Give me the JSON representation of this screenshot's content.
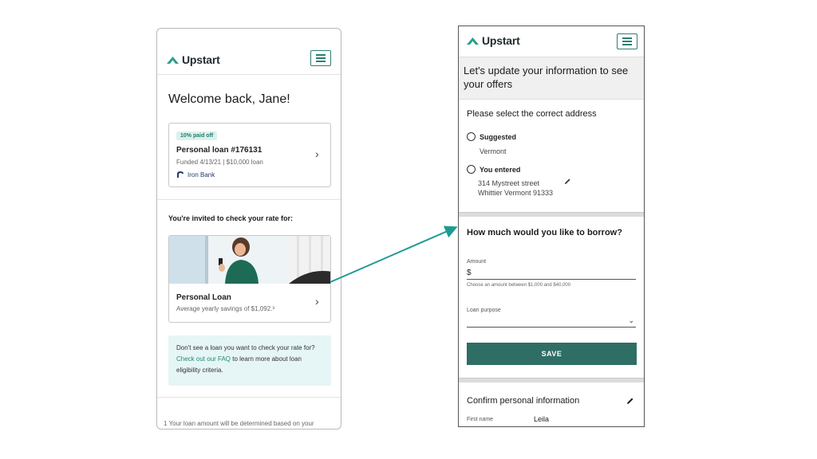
{
  "left_screen": {
    "brand": "Upstart",
    "welcome": "Welcome back, Jane!",
    "loan_card": {
      "badge": "10% paid off",
      "title": "Personal loan #176131",
      "subtitle": "Funded 4/13/21 | $10,000 loan",
      "bank": "Iron Bank"
    },
    "invite_heading": "You're invited to check your rate for:",
    "offer_card": {
      "title": "Personal Loan",
      "subtitle": "Average yearly savings of $1,092.³"
    },
    "faq": {
      "before": "Don't see a loan you want to check your rate for? ",
      "link": "Check out our FAQ",
      "after": " to learn more about loan eligibility criteria."
    },
    "footnote": "1 Your loan amount will be determined based on your"
  },
  "right_screen": {
    "brand": "Upstart",
    "banner": "Let's update your information to see your offers",
    "address": {
      "title": "Please select the correct address",
      "suggested_label": "Suggested",
      "suggested_value": "Vermont",
      "entered_label": "You entered",
      "entered_line1": "314 Mystreet street",
      "entered_line2": "Whittier Vermont 91333"
    },
    "borrow": {
      "title": "How much would you like to borrow?",
      "amount_label": "Amount",
      "amount_prefix": "$",
      "amount_help": "Choose an amount between $1,000 and $40,000",
      "purpose_label": "Loan purpose",
      "save_label": "SAVE"
    },
    "personal": {
      "title": "Confirm personal information",
      "first_name_label": "First name",
      "first_name_value": "Leila"
    }
  },
  "colors": {
    "brand_teal": "#2b9e8a",
    "button_teal": "#2e6e65",
    "arrow_teal": "#1f9a93",
    "faq_background": "#e6f5f6",
    "bank_navy": "#243c6b"
  },
  "icons": [
    "upstart-logo-icon",
    "hamburger-menu-icon",
    "chevron-right-icon",
    "iron-bank-icon",
    "pencil-edit-icon",
    "chevron-down-icon",
    "radio-button-icon"
  ]
}
